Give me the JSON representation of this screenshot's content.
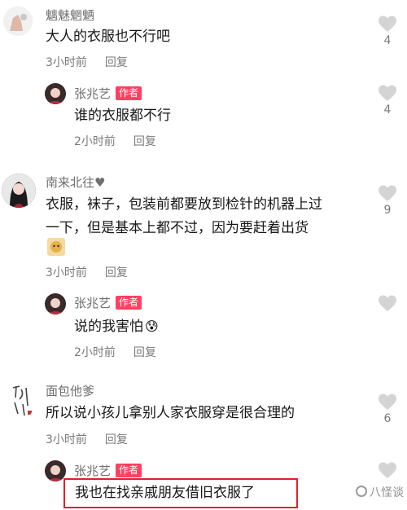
{
  "colors": {
    "author_badge": "#ff4060",
    "highlight_border": "#e3202a",
    "like_icon": "#d4d4d4"
  },
  "comments": [
    {
      "user": "魑魅魍魉",
      "text": "大人的衣服也不行吧",
      "time": "3小时前",
      "reply": "回复",
      "likes": "4"
    },
    {
      "user": "张兆艺",
      "badge": "作者",
      "text": "谁的衣服都不行",
      "time": "2小时前",
      "reply": "回复",
      "likes": "4"
    },
    {
      "user": "南来北往♥",
      "text_line1": "衣服，袜子，包装前都要放到检针的机器上过",
      "text_line2": "一下，但是基本上都不过，因为要赶着出货",
      "time": "3小时前",
      "reply": "回复",
      "likes": "9"
    },
    {
      "user": "张兆艺",
      "badge": "作者",
      "text": "说的我害怕",
      "emoji": "😰",
      "time": "2小时前",
      "reply": "回复",
      "likes": ""
    },
    {
      "user": "面包他爹",
      "text": "所以说小孩儿拿别人家衣服穿是很合理的",
      "time": "3小时前",
      "reply": "回复",
      "likes": "6"
    },
    {
      "user": "张兆艺",
      "badge": "作者",
      "text": "我也在找亲戚朋友借旧衣服了",
      "likes": ""
    }
  ],
  "watermark": "八怪谈"
}
